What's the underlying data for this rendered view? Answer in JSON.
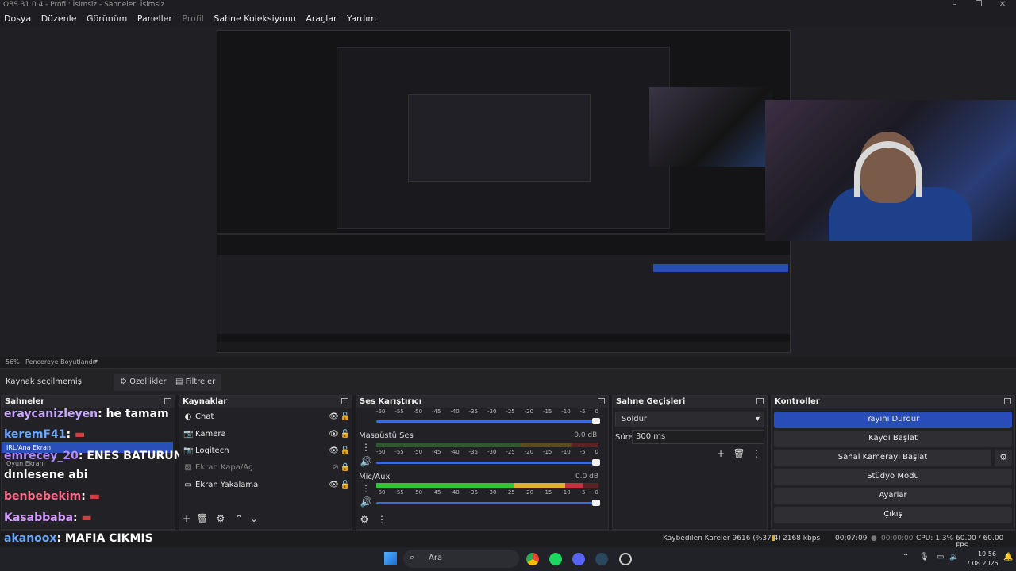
{
  "window": {
    "title": "OBS 31.0.4 - Profil: İsimsiz - Sahneler: İsimsiz"
  },
  "menu": [
    "Dosya",
    "Düzenle",
    "Görünüm",
    "Paneller",
    "Profil",
    "Sahne Koleksiyonu",
    "Araçlar",
    "Yardım"
  ],
  "preview": {
    "zoom": "56%",
    "zoom_mode": "Pencereye Boyutlandır"
  },
  "source_bar": {
    "selected": "Kaynak seçilmemiş",
    "properties": "Özellikler",
    "filters": "Filtreler"
  },
  "scenes": {
    "title": "Sahneler",
    "items": [
      "IRL/Ana Ekran",
      "Oyun Ekranı"
    ]
  },
  "chat": [
    {
      "user": "eraycanizleyen",
      "msg": ": he tamam",
      "color": "#c9a8ff"
    },
    {
      "user": "keremF41",
      "msg": ":",
      "color": "#6aa8ff"
    },
    {
      "user": "emrecey_20",
      "msg": ": ENES BATURUN cikardığı şarkıyı",
      "color": "#b08cff"
    },
    {
      "user": "",
      "msg": "dınlesene abi",
      "color": "#ffffff"
    },
    {
      "user": "benbebekim",
      "msg": ":",
      "color": "#ff6b8a"
    },
    {
      "user": "Kasabbaba",
      "msg": ":",
      "color": "#d69cff"
    },
    {
      "user": "akanoox",
      "msg": ": MAFIA CIKMIS",
      "color": "#6aa8ff"
    }
  ],
  "sources": {
    "title": "Kaynaklar",
    "items": [
      "Chat",
      "Kamera",
      "Logitech",
      "Ekran Kapa/Aç",
      "Ekran Yakalama"
    ]
  },
  "mixer": {
    "title": "Ses Karıştırıcı",
    "ticks": [
      "-60",
      "-55",
      "-50",
      "-45",
      "-40",
      "-35",
      "-30",
      "-25",
      "-20",
      "-15",
      "-10",
      "-5",
      "0"
    ],
    "channels": [
      {
        "name": "Masaüstü Ses",
        "db": "-0.0 dB",
        "level": 0.0
      },
      {
        "name": "Mic/Aux",
        "db": "0.0 dB",
        "level": 0.93
      }
    ]
  },
  "transitions": {
    "title": "Sahne Geçişleri",
    "type": "Soldur",
    "duration_label": "Süre",
    "duration": "300 ms"
  },
  "controls": {
    "title": "Kontroller",
    "buttons": [
      "Yayını Durdur",
      "Kaydı Başlat",
      "Sanal Kamerayı Başlat",
      "Stüdyo Modu",
      "Ayarlar",
      "Çıkış"
    ]
  },
  "status": {
    "dropped": "Kaybedilen Kareler 9616 (%37.4)",
    "bitrate": "2168 kbps",
    "stream_time": "00:07:09",
    "rec_time": "00:00:00",
    "cpu": "CPU: 1.3%",
    "fps": "60.00 / 60.00 FPS"
  },
  "taskbar": {
    "search": "Ara",
    "time": "19:56",
    "date": "7.08.2025"
  }
}
